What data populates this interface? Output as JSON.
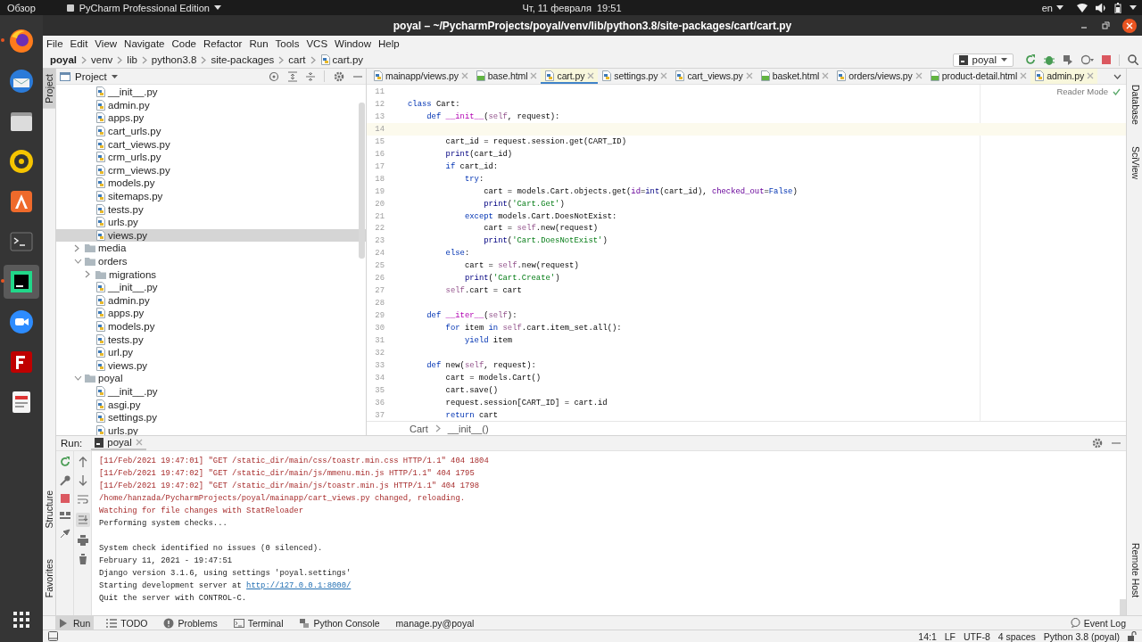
{
  "top_bar": {
    "activities": "Обзор",
    "app_menu": "PyCharm Professional Edition",
    "clock": "Чт, 11 февраля  19:51",
    "keyboard": "en"
  },
  "dock": {
    "apps": [
      {
        "kind": "browser",
        "running": true,
        "selected": false
      },
      {
        "kind": "mail",
        "running": false,
        "selected": false
      },
      {
        "kind": "files",
        "running": false,
        "selected": false
      },
      {
        "kind": "music",
        "running": false,
        "selected": false
      },
      {
        "kind": "store",
        "running": false,
        "selected": false
      },
      {
        "kind": "terminal",
        "running": false,
        "selected": false
      },
      {
        "kind": "ide",
        "running": true,
        "selected": true
      },
      {
        "kind": "video",
        "running": false,
        "selected": false
      },
      {
        "kind": "ftp",
        "running": false,
        "selected": false
      },
      {
        "kind": "document",
        "running": false,
        "selected": false
      }
    ]
  },
  "window": {
    "title": "poyal – ~/PycharmProjects/poyal/venv/lib/python3.8/site-packages/cart/cart.py"
  },
  "menu": [
    "File",
    "Edit",
    "View",
    "Navigate",
    "Code",
    "Refactor",
    "Run",
    "Tools",
    "VCS",
    "Window",
    "Help"
  ],
  "nav_bar": {
    "crumbs": [
      "poyal",
      "venv",
      "lib",
      "python3.8",
      "site-packages",
      "cart",
      "cart.py"
    ],
    "run_config": "poyal"
  },
  "side_tabs": {
    "left_top": [
      {
        "label": "Project",
        "selected": true
      }
    ],
    "left_bottom": [
      {
        "label": "Structure",
        "selected": false
      },
      {
        "label": "Favorites",
        "selected": false
      }
    ],
    "right_top": [
      {
        "label": "Database",
        "selected": false
      },
      {
        "label": "SciView",
        "selected": false
      }
    ],
    "right_bottom": [
      {
        "label": "Remote Host",
        "selected": false
      }
    ]
  },
  "project_panel": {
    "title": "Project",
    "tree": [
      {
        "children": [
          {
            "label": "__init__.py",
            "kind": "py",
            "selected": false
          },
          {
            "label": "admin.py",
            "kind": "py",
            "selected": false
          },
          {
            "label": "apps.py",
            "kind": "py",
            "selected": false
          },
          {
            "label": "cart_urls.py",
            "kind": "py",
            "selected": false
          },
          {
            "label": "cart_views.py",
            "kind": "py",
            "selected": false
          },
          {
            "label": "crm_urls.py",
            "kind": "py",
            "selected": false
          },
          {
            "label": "crm_views.py",
            "kind": "py",
            "selected": false
          },
          {
            "label": "models.py",
            "kind": "py",
            "selected": false
          },
          {
            "label": "sitemaps.py",
            "kind": "py",
            "selected": false
          },
          {
            "label": "tests.py",
            "kind": "py",
            "selected": false
          },
          {
            "label": "urls.py",
            "kind": "py",
            "selected": false
          },
          {
            "label": "views.py",
            "kind": "py",
            "selected": true
          }
        ]
      },
      {
        "label": "media",
        "kind": "folder",
        "expanded": false,
        "selected": false
      },
      {
        "label": "orders",
        "kind": "folder",
        "expanded": true,
        "selected": false,
        "children": [
          {
            "label": "migrations",
            "kind": "folder",
            "expanded": false,
            "selected": false
          },
          {
            "label": "__init__.py",
            "kind": "py",
            "selected": false
          },
          {
            "label": "admin.py",
            "kind": "py",
            "selected": false
          },
          {
            "label": "apps.py",
            "kind": "py",
            "selected": false
          },
          {
            "label": "models.py",
            "kind": "py",
            "selected": false
          },
          {
            "label": "tests.py",
            "kind": "py",
            "selected": false
          },
          {
            "label": "url.py",
            "kind": "py",
            "selected": false
          },
          {
            "label": "views.py",
            "kind": "py",
            "selected": false
          }
        ]
      },
      {
        "label": "poyal",
        "kind": "folder",
        "expanded": true,
        "selected": false,
        "children": [
          {
            "label": "__init__.py",
            "kind": "py",
            "selected": false
          },
          {
            "label": "asgi.py",
            "kind": "py",
            "selected": false
          },
          {
            "label": "settings.py",
            "kind": "py",
            "selected": false
          },
          {
            "label": "urls.py",
            "kind": "py",
            "selected": false
          }
        ]
      }
    ]
  },
  "editor": {
    "tabs": [
      {
        "label": "mainapp/views.py",
        "kind": "py",
        "selected": false,
        "external": false
      },
      {
        "label": "base.html",
        "kind": "html",
        "selected": false,
        "external": false
      },
      {
        "label": "cart.py",
        "kind": "py",
        "selected": true,
        "external": true
      },
      {
        "label": "settings.py",
        "kind": "py",
        "selected": false,
        "external": false
      },
      {
        "label": "cart_views.py",
        "kind": "py",
        "selected": false,
        "external": false
      },
      {
        "label": "basket.html",
        "kind": "html",
        "selected": false,
        "external": false
      },
      {
        "label": "orders/views.py",
        "kind": "py",
        "selected": false,
        "external": false
      },
      {
        "label": "product-detail.html",
        "kind": "html",
        "selected": false,
        "external": false
      },
      {
        "label": "admin.py",
        "kind": "py",
        "selected": false,
        "external": true
      }
    ],
    "reader_mode": "Reader Mode",
    "lines": [
      {
        "no": "11",
        "current": false
      },
      {
        "no": "12",
        "current": false,
        "tokens": [
          {
            "kind": "kw",
            "text": "class"
          },
          {
            "kind": "plain",
            "text": " Cart:"
          }
        ]
      },
      {
        "no": "13",
        "current": false,
        "tokens": [
          {
            "kind": "kw",
            "text": "    def "
          },
          {
            "kind": "magic",
            "text": "__init__"
          },
          {
            "kind": "plain",
            "text": "("
          },
          {
            "kind": "self",
            "text": "self"
          },
          {
            "kind": "plain",
            "text": ", request):"
          }
        ]
      },
      {
        "no": "14",
        "current": true
      },
      {
        "no": "15",
        "current": false,
        "tokens": [
          {
            "kind": "plain",
            "text": "        cart_id = request.session.get(CART_ID)"
          }
        ]
      },
      {
        "no": "16",
        "current": false,
        "tokens": [
          {
            "kind": "builtin",
            "text": "        print"
          },
          {
            "kind": "plain",
            "text": "(cart_id)"
          }
        ]
      },
      {
        "no": "17",
        "current": false,
        "tokens": [
          {
            "kind": "kw",
            "text": "        if"
          },
          {
            "kind": "plain",
            "text": " cart_id:"
          }
        ]
      },
      {
        "no": "18",
        "current": false,
        "tokens": [
          {
            "kind": "kw",
            "text": "            try"
          },
          {
            "kind": "plain",
            "text": ":"
          }
        ]
      },
      {
        "no": "19",
        "current": false,
        "tokens": [
          {
            "kind": "plain",
            "text": "                cart = models.Cart.objects.get("
          },
          {
            "kind": "param",
            "text": "id"
          },
          {
            "kind": "plain",
            "text": "="
          },
          {
            "kind": "builtin",
            "text": "int"
          },
          {
            "kind": "plain",
            "text": "(cart_id), "
          },
          {
            "kind": "param",
            "text": "checked_out"
          },
          {
            "kind": "plain",
            "text": "="
          },
          {
            "kind": "kw",
            "text": "False"
          },
          {
            "kind": "plain",
            "text": ")"
          }
        ]
      },
      {
        "no": "20",
        "current": false,
        "tokens": [
          {
            "kind": "builtin",
            "text": "                print"
          },
          {
            "kind": "plain",
            "text": "("
          },
          {
            "kind": "str",
            "text": "'Cart.Get'"
          },
          {
            "kind": "plain",
            "text": ")"
          }
        ]
      },
      {
        "no": "21",
        "current": false,
        "tokens": [
          {
            "kind": "kw",
            "text": "            except"
          },
          {
            "kind": "plain",
            "text": " models.Cart.DoesNotExist:"
          }
        ]
      },
      {
        "no": "22",
        "current": false,
        "tokens": [
          {
            "kind": "plain",
            "text": "                cart = "
          },
          {
            "kind": "self",
            "text": "self"
          },
          {
            "kind": "plain",
            "text": ".new(request)"
          }
        ]
      },
      {
        "no": "23",
        "current": false,
        "tokens": [
          {
            "kind": "builtin",
            "text": "                print"
          },
          {
            "kind": "plain",
            "text": "("
          },
          {
            "kind": "str",
            "text": "'Cart.DoesNotExist'"
          },
          {
            "kind": "plain",
            "text": ")"
          }
        ]
      },
      {
        "no": "24",
        "current": false,
        "tokens": [
          {
            "kind": "kw",
            "text": "        else"
          },
          {
            "kind": "plain",
            "text": ":"
          }
        ]
      },
      {
        "no": "25",
        "current": false,
        "tokens": [
          {
            "kind": "plain",
            "text": "            cart = "
          },
          {
            "kind": "self",
            "text": "self"
          },
          {
            "kind": "plain",
            "text": ".new(request)"
          }
        ]
      },
      {
        "no": "26",
        "current": false,
        "tokens": [
          {
            "kind": "builtin",
            "text": "            print"
          },
          {
            "kind": "plain",
            "text": "("
          },
          {
            "kind": "str",
            "text": "'Cart.Create'"
          },
          {
            "kind": "plain",
            "text": ")"
          }
        ]
      },
      {
        "no": "27",
        "current": false,
        "tokens": [
          {
            "kind": "self",
            "text": "        self"
          },
          {
            "kind": "plain",
            "text": ".cart = cart"
          }
        ]
      },
      {
        "no": "28",
        "current": false
      },
      {
        "no": "29",
        "current": false,
        "tokens": [
          {
            "kind": "kw",
            "text": "    def "
          },
          {
            "kind": "magic",
            "text": "__iter__"
          },
          {
            "kind": "plain",
            "text": "("
          },
          {
            "kind": "self",
            "text": "self"
          },
          {
            "kind": "plain",
            "text": "):"
          }
        ]
      },
      {
        "no": "30",
        "current": false,
        "tokens": [
          {
            "kind": "kw",
            "text": "        for"
          },
          {
            "kind": "plain",
            "text": " item "
          },
          {
            "kind": "kw",
            "text": "in "
          },
          {
            "kind": "self",
            "text": "self"
          },
          {
            "kind": "plain",
            "text": ".cart.item_set.all():"
          }
        ]
      },
      {
        "no": "31",
        "current": false,
        "tokens": [
          {
            "kind": "kw",
            "text": "            yield"
          },
          {
            "kind": "plain",
            "text": " item"
          }
        ]
      },
      {
        "no": "32",
        "current": false
      },
      {
        "no": "33",
        "current": false,
        "tokens": [
          {
            "kind": "kw",
            "text": "    def"
          },
          {
            "kind": "plain",
            "text": " new("
          },
          {
            "kind": "self",
            "text": "self"
          },
          {
            "kind": "plain",
            "text": ", request):"
          }
        ]
      },
      {
        "no": "34",
        "current": false,
        "tokens": [
          {
            "kind": "plain",
            "text": "        cart = models.Cart()"
          }
        ]
      },
      {
        "no": "35",
        "current": false,
        "tokens": [
          {
            "kind": "plain",
            "text": "        cart.save()"
          }
        ]
      },
      {
        "no": "36",
        "current": false,
        "tokens": [
          {
            "kind": "plain",
            "text": "        request.session[CART_ID] = cart.id"
          }
        ]
      },
      {
        "no": "37",
        "current": false,
        "tokens": [
          {
            "kind": "kw",
            "text": "        return"
          },
          {
            "kind": "plain",
            "text": " cart"
          }
        ]
      }
    ],
    "breadcrumbs": [
      "Cart",
      "__init__()"
    ]
  },
  "run_panel": {
    "label": "Run:",
    "tab": "poyal",
    "console_blocks": [
      {
        "lines": [
          {
            "kind": "error",
            "text": "[11/Feb/2021 19:47:01] \"GET /static_dir/main/css/toastr.min.css HTTP/1.1\" 404 1804"
          },
          {
            "kind": "error",
            "text": "[11/Feb/2021 19:47:02] \"GET /static_dir/main/js/mmenu.min.js HTTP/1.1\" 404 1795"
          },
          {
            "kind": "error",
            "text": "[11/Feb/2021 19:47:02] \"GET /static_dir/main/js/toastr.min.js HTTP/1.1\" 404 1798"
          },
          {
            "kind": "error",
            "text": "/home/hanzada/PycharmProjects/poyal/mainapp/cart_views.py changed, reloading."
          },
          {
            "kind": "error",
            "text": "Watching for file changes with StatReloader"
          },
          {
            "kind": "info",
            "text": "Performing system checks..."
          }
        ]
      },
      {
        "lines": [
          {
            "kind": "info",
            "text": "System check identified no issues (0 silenced)."
          },
          {
            "kind": "info",
            "text": "February 11, 2021 - 19:47:51"
          },
          {
            "kind": "info",
            "text": "Django version 3.1.6, using settings 'poyal.settings'"
          },
          {
            "kind": "info",
            "text": "Starting development server at ",
            "link": "http://127.0.0.1:8000/"
          },
          {
            "kind": "info",
            "text": "Quit the server with CONTROL-C."
          }
        ]
      }
    ]
  },
  "tool_tabs": [
    {
      "label": "Run",
      "kind": "run",
      "selected": true
    },
    {
      "label": "TODO",
      "kind": "todo",
      "selected": false
    },
    {
      "label": "Problems",
      "kind": "problems",
      "selected": false
    },
    {
      "label": "Terminal",
      "kind": "terminal",
      "selected": false
    },
    {
      "label": "Python Console",
      "kind": "console",
      "selected": false
    },
    {
      "label": "manage.py@poyal",
      "kind": "plain",
      "selected": false
    }
  ],
  "event_log": "Event Log",
  "status_bar": [
    "14:1",
    "LF",
    "UTF-8",
    "4 spaces",
    "Python 3.8 (poyal)"
  ]
}
